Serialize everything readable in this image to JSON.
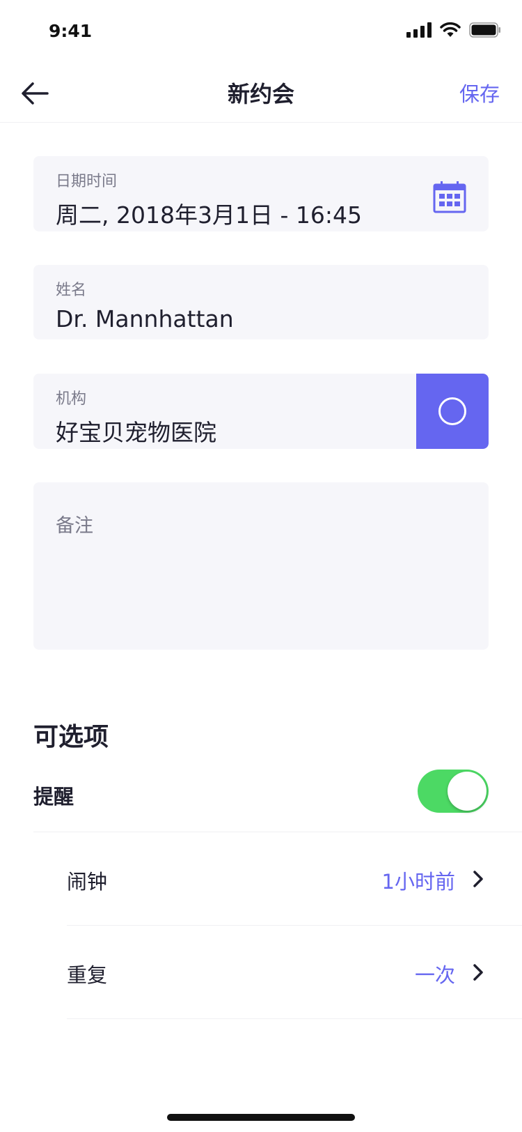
{
  "status_bar": {
    "time": "9:41"
  },
  "nav": {
    "title": "新约会",
    "save_label": "保存"
  },
  "form": {
    "datetime": {
      "label": "日期时间",
      "value": "周二, 2018年3月1日 - 16:45"
    },
    "name": {
      "label": "姓名",
      "value": "Dr. Mannhattan"
    },
    "organization": {
      "label": "机构",
      "value": "好宝贝宠物医院"
    },
    "notes": {
      "placeholder": "备注"
    }
  },
  "options": {
    "title": "可选项",
    "reminder": {
      "label": "提醒",
      "enabled": true
    },
    "rows": [
      {
        "label": "闹钟",
        "value": "1小时前"
      },
      {
        "label": "重复",
        "value": "一次"
      }
    ]
  },
  "colors": {
    "accent": "#6566f0",
    "toggle_on": "#4cd964",
    "field_bg": "#f6f6fa"
  },
  "icons": [
    "back-arrow-icon",
    "calendar-icon",
    "circle-icon",
    "chevron-right-icon",
    "signal-icon",
    "wifi-icon",
    "battery-icon"
  ]
}
